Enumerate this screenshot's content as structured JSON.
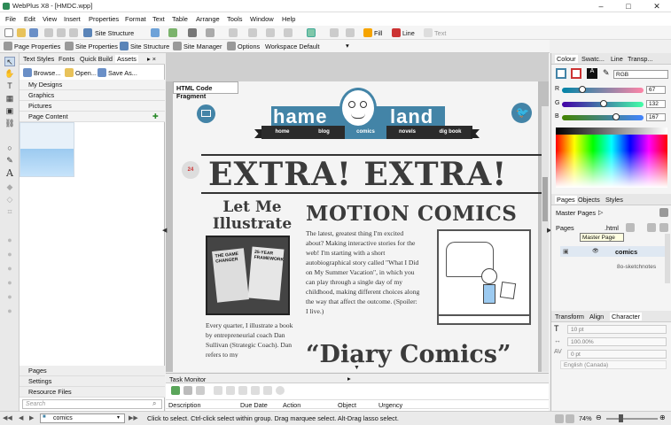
{
  "window": {
    "title": "WebPlus X8 - [HMDC.wpp]",
    "minimize": "–",
    "maximize": "□",
    "close": "✕"
  },
  "menu": [
    "File",
    "Edit",
    "View",
    "Insert",
    "Properties",
    "Format",
    "Text",
    "Table",
    "Arrange",
    "Tools",
    "Window",
    "Help"
  ],
  "toolbar1": {
    "site_structure": "Site Structure",
    "fill": "Fill",
    "line": "Line",
    "text": "Text"
  },
  "toolbar2": {
    "page_properties": "Page Properties",
    "site_properties": "Site Properties",
    "site_structure": "Site Structure",
    "site_manager": "Site Manager",
    "options": "Options",
    "workspace": "Workspace Default"
  },
  "left_panel": {
    "tabs": [
      "Text Styles",
      "Fonts",
      "Quick Build",
      "Assets"
    ],
    "browse": "Browse...",
    "open": "Open...",
    "save_as": "Save As...",
    "categories": [
      "My Designs",
      "Graphics",
      "Pictures",
      "Page Content"
    ],
    "bottom_tabs": [
      "Pages",
      "Settings",
      "Resource Files"
    ],
    "search_placeholder": "Search"
  },
  "canvas": {
    "fragment_label": "HTML Code Fragment",
    "logo_left": "hame",
    "logo_right": "land",
    "nav": [
      "home",
      "blog",
      "comics",
      "novels",
      "dig book"
    ],
    "headline": "EXTRA! EXTRA!",
    "col1_title": "Let Me Illustrate",
    "book1_title": "THE GAME CHANGER",
    "book2_title": "25-YEAR FRAMEWORK",
    "col1_text": "Every quarter, I illustrate a book by entrepreneurial coach Dan Sullivan (Strategic Coach). Dan refers to my",
    "col2_title": "MOTION COMICS",
    "col2_text": "The latest, greatest thing I'm excited about? Making interactive stories for the web! I'm starting with a short autobiographical story called \"What I Did on My Summer Vacation\", in which you can play through a single day of my childhood, making different choices along the way that affect the outcome. (Spoiler: I live.)",
    "col2_subtitle": "“Diary Comics”",
    "badge": "24"
  },
  "right_panel": {
    "tabs": [
      "Colour",
      "Swatc...",
      "Line",
      "Transp..."
    ],
    "model": "RGB",
    "r": 67,
    "g": 132,
    "b": 167,
    "r_label": "R",
    "g_label": "G",
    "b_label": "B",
    "pages_tabs": [
      "Pages",
      "Objects",
      "Styles"
    ],
    "master_pages": "Master Pages",
    "pages_label": "Pages",
    "html_item": ".html",
    "tooltip": "Master Page",
    "tree": [
      "comics",
      "8o-sketchnotes"
    ],
    "char_tabs": [
      "Transform",
      "Align",
      "Character"
    ],
    "font_size": "10 pt",
    "scale": "100.00%",
    "spacing": "0 pt",
    "language": "English (Canada)",
    "accent": "#4384a7"
  },
  "task_monitor": {
    "title": "Task Monitor",
    "columns": [
      "Description",
      "Due Date",
      "Action",
      "Object",
      "Urgency"
    ]
  },
  "status": {
    "page_value": "comics",
    "hint": "Click to select. Ctrl-click select within group. Drag marquee select. Alt-Drag lasso select.",
    "zoom": "74%"
  }
}
